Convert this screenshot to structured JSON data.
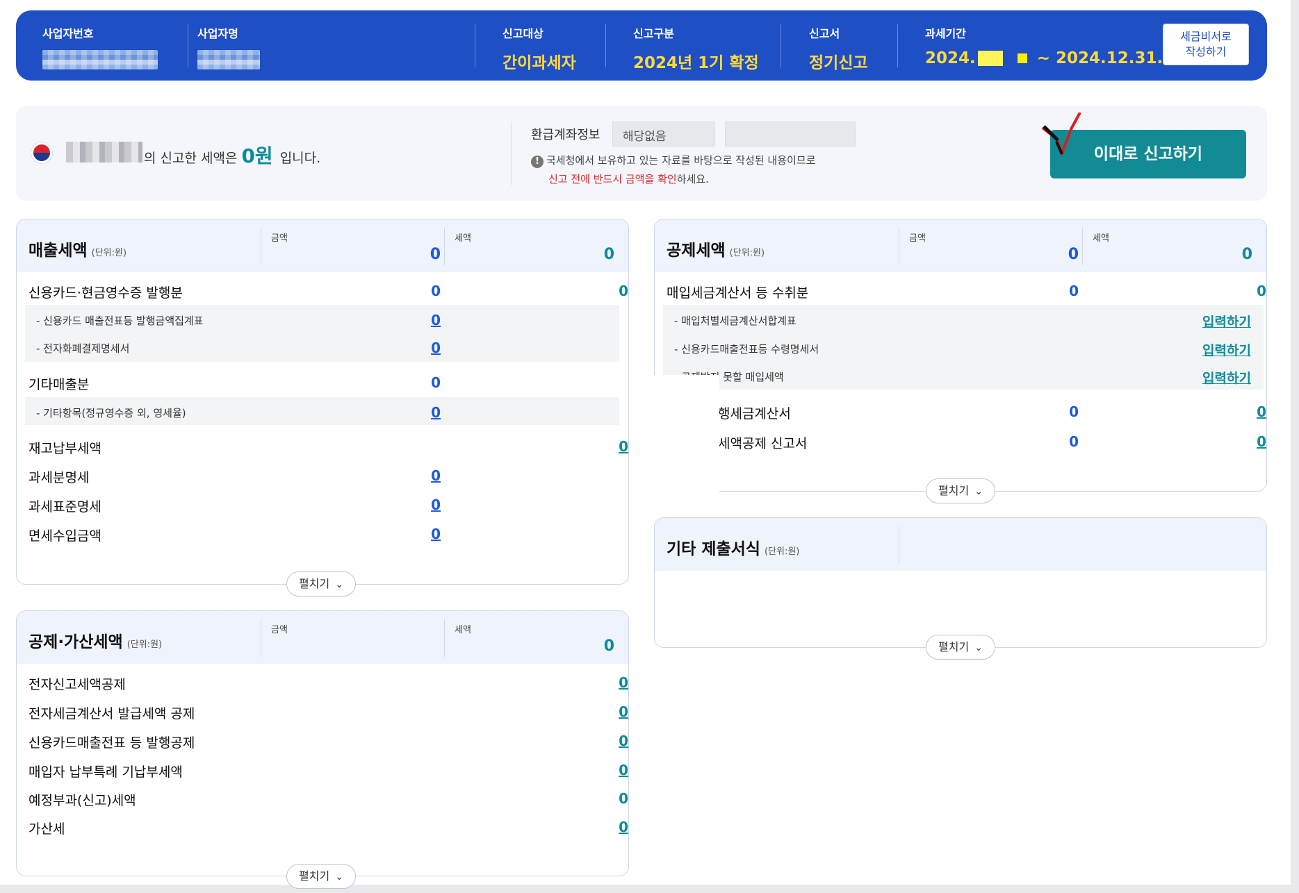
{
  "header": {
    "business_number_label": "사업자번호",
    "business_name_label": "사업자명",
    "target_label": "신고대상",
    "target_value": "간이과세자",
    "category_label": "신고구분",
    "category_value": "2024년 1기 확정",
    "form_label": "신고서",
    "form_value": "정기신고",
    "period_label": "과세기간",
    "period_start_prefix": "2024.",
    "period_end": "~ 2024.12.31.",
    "tax_secretary_button": "세금비서로\n작성하기"
  },
  "summary": {
    "text_suffix": "의 신고한 세액은",
    "amount": "0원",
    "text_end": "입니다.",
    "refund_label": "환급계좌정보",
    "refund_value": "해당없음",
    "notice_line1": "국세청에서 보유하고 있는 자료를 바탕으로 작성된 내용이므로",
    "notice_red": "신고 전에 반드시 금액을 확인",
    "notice_end": "하세요.",
    "file_button": "이대로 신고하기"
  },
  "common": {
    "unit": "(단위:원)",
    "amount_col": "금액",
    "tax_col": "세액",
    "expand": "펼치기",
    "input": "입력하기"
  },
  "sales": {
    "title": "매출세액",
    "total_amount": "0",
    "total_tax": "0",
    "rows": [
      {
        "label": "신용카드·현금영수증 발행분",
        "amount": "0",
        "tax": "0"
      },
      {
        "label": "- 신용카드 매출전표등 발행금액집계표",
        "amount": "0"
      },
      {
        "label": "- 전자화폐결제명세서",
        "amount": "0"
      },
      {
        "label": "기타매출분",
        "amount": "0"
      },
      {
        "label": "- 기타항목(정규영수증 외, 영세율)",
        "amount": "0"
      },
      {
        "label": "재고납부세액",
        "tax": "0"
      },
      {
        "label": "과세분명세",
        "amount": "0"
      },
      {
        "label": "과세표준명세",
        "amount": "0"
      },
      {
        "label": "면세수입금액",
        "amount": "0"
      }
    ]
  },
  "deduction_add": {
    "title": "공제·가산세액",
    "total_tax": "0",
    "rows": [
      {
        "label": "전자신고세액공제",
        "tax": "0"
      },
      {
        "label": "전자세금계산서 발급세액 공제",
        "tax": "0"
      },
      {
        "label": "신용카드매출전표 등 발행공제",
        "tax": "0"
      },
      {
        "label": "매입자 납부특례 기납부세액",
        "tax": "0"
      },
      {
        "label": "예정부과(신고)세액",
        "tax": "0"
      },
      {
        "label": "가산세",
        "tax": "0"
      }
    ]
  },
  "deduction": {
    "title": "공제세액",
    "total_amount": "0",
    "total_tax": "0",
    "rows": [
      {
        "label": "매입세금계산서 등 수취분",
        "amount": "0",
        "tax": "0"
      },
      {
        "label": "- 매입처별세금계산서합계표"
      },
      {
        "label": "- 신용카드매출전표등 수령명세서"
      },
      {
        "label": "- 공제받지 못할 매입세액"
      },
      {
        "label": "행세금계산서",
        "amount": "0",
        "tax": "0"
      },
      {
        "label": "세액공제 신고서",
        "amount": "0",
        "tax": "0"
      }
    ]
  },
  "other": {
    "title": "기타 제출서식"
  }
}
